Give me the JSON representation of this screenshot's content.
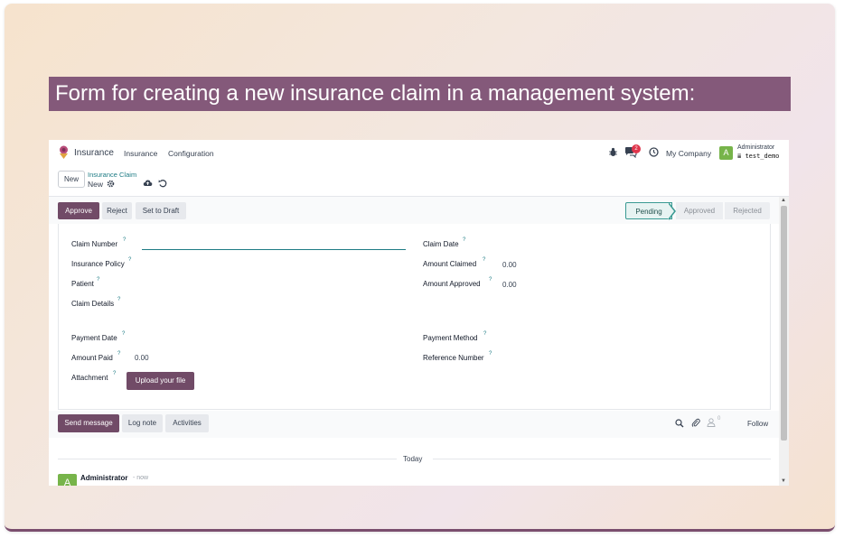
{
  "caption": "Form for creating a new insurance claim in a management system:",
  "topnav": {
    "app_name": "Insurance",
    "menu": [
      "Insurance",
      "Configuration"
    ],
    "chat_badge": "2",
    "company": "My Company",
    "avatar_letter": "A",
    "user_name": "Administrator",
    "db_name": "test_demo"
  },
  "breadcrumb": {
    "new_label": "New",
    "parent": "Insurance Claim",
    "current": "New"
  },
  "actions": {
    "approve": "Approve",
    "reject": "Reject",
    "set_to_draft": "Set to Draft"
  },
  "stages": {
    "pending": "Pending",
    "approved": "Approved",
    "rejected": "Rejected",
    "active": "Pending"
  },
  "form": {
    "help_mark": "?",
    "claim_number": "Claim Number",
    "insurance_policy": "Insurance Policy",
    "patient": "Patient",
    "claim_details": "Claim Details",
    "payment_date": "Payment Date",
    "amount_paid": "Amount Paid",
    "amount_paid_value": "0.00",
    "attachment": "Attachment",
    "upload": "Upload your file",
    "claim_date": "Claim Date",
    "amount_claimed": "Amount Claimed",
    "amount_claimed_value": "0.00",
    "amount_approved": "Amount Approved",
    "amount_approved_value": "0.00",
    "payment_method": "Payment Method",
    "reference_number": "Reference Number"
  },
  "chatter": {
    "send_message": "Send message",
    "log_note": "Log note",
    "activities": "Activities",
    "follower_count": "0",
    "follow": "Follow",
    "today": "Today",
    "author": "Administrator",
    "time": "- now",
    "avatar_letter": "A"
  },
  "colors": {
    "brand": "#714b67",
    "teal": "#1d7b84",
    "avatar": "#77b44a"
  }
}
